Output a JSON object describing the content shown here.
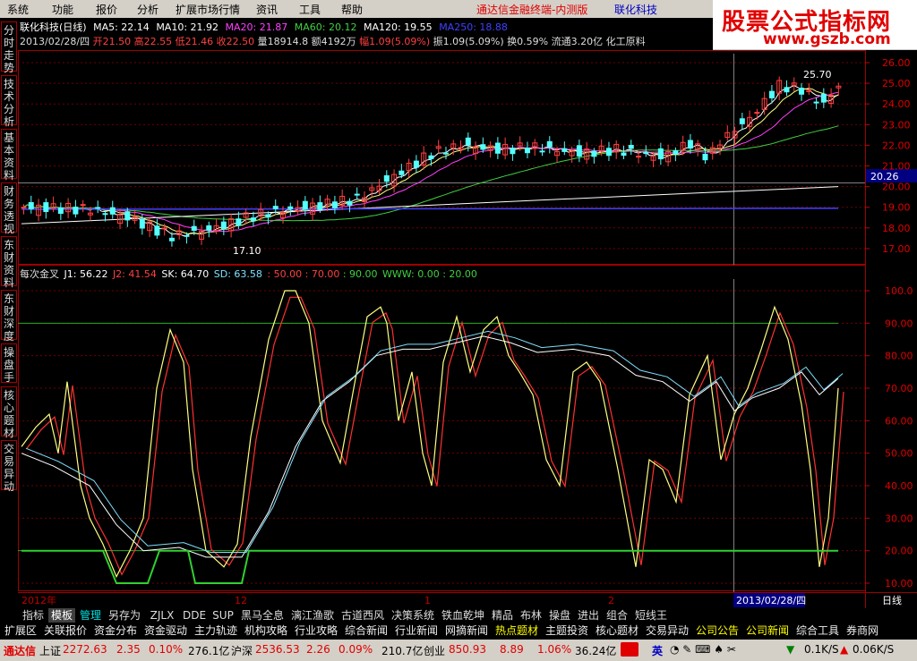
{
  "menu": [
    "系统",
    "功能",
    "报价",
    "分析",
    "扩展市场行情",
    "资讯",
    "工具",
    "帮助"
  ],
  "promo": "通达信金融终端-内测版",
  "stock_title": "联化科技",
  "logo": {
    "text": "股票公式指标网",
    "url": "www.gszb.com"
  },
  "side_tabs": [
    "分时走势",
    "技术分析",
    "基本资料",
    "财务透视",
    "东财资料",
    "东财深度",
    "操盘手",
    "核心题材",
    "交易异动"
  ],
  "price_panel": {
    "line1": [
      {
        "text": "联化科技(日线)",
        "color": "#ffffff"
      },
      {
        "text": "MA5: 22.14",
        "color": "#ffffff"
      },
      {
        "text": "MA10: 21.92",
        "color": "#ffffff"
      },
      {
        "text": "MA20: 21.87",
        "color": "#ff40ff"
      },
      {
        "text": "MA60: 20.12",
        "color": "#40d040"
      },
      {
        "text": "MA120: 19.55",
        "color": "#ffffff"
      },
      {
        "text": "MA250: 18.88",
        "color": "#4040ff"
      }
    ],
    "line2": [
      {
        "text": "2013/02/28/四",
        "color": "#dddddd"
      },
      {
        "text": "开21.50",
        "color": "#ff4040"
      },
      {
        "text": "高22.55",
        "color": "#ff4040"
      },
      {
        "text": "低21.46",
        "color": "#ff4040"
      },
      {
        "text": "收22.50",
        "color": "#ff4040"
      },
      {
        "text": "量18914.8",
        "color": "#dddddd"
      },
      {
        "text": "额4192万",
        "color": "#dddddd"
      },
      {
        "text": "幅1.09(5.09%)",
        "color": "#ff4040"
      },
      {
        "text": "振1.09(5.09%)",
        "color": "#dddddd"
      },
      {
        "text": "换0.59%",
        "color": "#dddddd"
      },
      {
        "text": "流通3.20亿",
        "color": "#dddddd"
      },
      {
        "text": "化工原料",
        "color": "#dddddd"
      }
    ],
    "high_label": "25.70",
    "low_label": "17.10",
    "current_price": "20.26",
    "y_labels": [
      "26.00",
      "25.00",
      "24.00",
      "23.00",
      "22.00",
      "21.00",
      "20.00",
      "19.00",
      "18.00",
      "17.00"
    ]
  },
  "kdj_panel": {
    "line": [
      {
        "text": "每次金叉",
        "color": "#dddddd"
      },
      {
        "text": "J1: 56.22",
        "color": "#ffffff"
      },
      {
        "text": "J2: 41.54",
        "color": "#ff4040"
      },
      {
        "text": "SK: 64.70",
        "color": "#ffffff"
      },
      {
        "text": "SD: 63.58",
        "color": "#80e0ff"
      },
      {
        "text": ": 50.00",
        "color": "#ff4040"
      },
      {
        "text": ": 70.00",
        "color": "#ff4040"
      },
      {
        "text": ": 90.00",
        "color": "#40d040"
      },
      {
        "text": "WWW: 0.00",
        "color": "#40d040"
      },
      {
        "text": ": 20.00",
        "color": "#40d040"
      }
    ],
    "y_labels": [
      "100.0",
      "90.00",
      "80.00",
      "70.00",
      "60.00",
      "50.00",
      "40.00",
      "30.00",
      "20.00",
      "10.00"
    ]
  },
  "x_axis": {
    "labels": [
      "2012年",
      "12",
      "1",
      "2"
    ],
    "current_date": "2013/02/28/四",
    "period": "日线"
  },
  "bottom_tabs1": [
    "指标",
    "模板",
    "管理",
    "另存为",
    "ZJLX",
    "DDE",
    "SUP",
    "黑马全息",
    "漓江渔歌",
    "古道西风",
    "决策系统",
    "铁血乾坤",
    "精品",
    "布林",
    "操盘",
    "进出",
    "组合",
    "短线王"
  ],
  "bottom_tabs2": [
    "扩展区",
    "关联报价",
    "资金分布",
    "资金驱动",
    "主力轨迹",
    "机构攻略",
    "行业攻略",
    "综合新闻",
    "行业新闻",
    "网摘新闻",
    "热点题材",
    "主题投资",
    "核心题材",
    "交易异动",
    "公司公告",
    "公司新闻",
    "综合工具",
    "券商网"
  ],
  "status": {
    "brand": "通达信",
    "sh_label": "上证",
    "sh_index": "2272.63",
    "sh_change": "2.35",
    "sh_pct": "0.10%",
    "sh_amount": "276.1亿",
    "sz_label": "沪深",
    "sz_index": "2536.53",
    "sz_change": "2.26",
    "sz_pct": "0.09%",
    "sz_amount": "210.7亿",
    "cy_label": "创业",
    "cy_index": "850.93",
    "cy_change": "8.89",
    "cy_pct": "1.06%",
    "cy_amount": "36.24亿",
    "ime": "英",
    "down_speed": "0.1K/S",
    "up_speed": "0.06K/S"
  },
  "colors": {
    "up": "#ff4040",
    "down": "#54ffff",
    "ma5": "#ffffff",
    "ma10": "#ffff80",
    "ma20": "#ff40ff",
    "ma60": "#40d040",
    "ma120": "#ffffff",
    "ma250": "#4040ff"
  }
}
